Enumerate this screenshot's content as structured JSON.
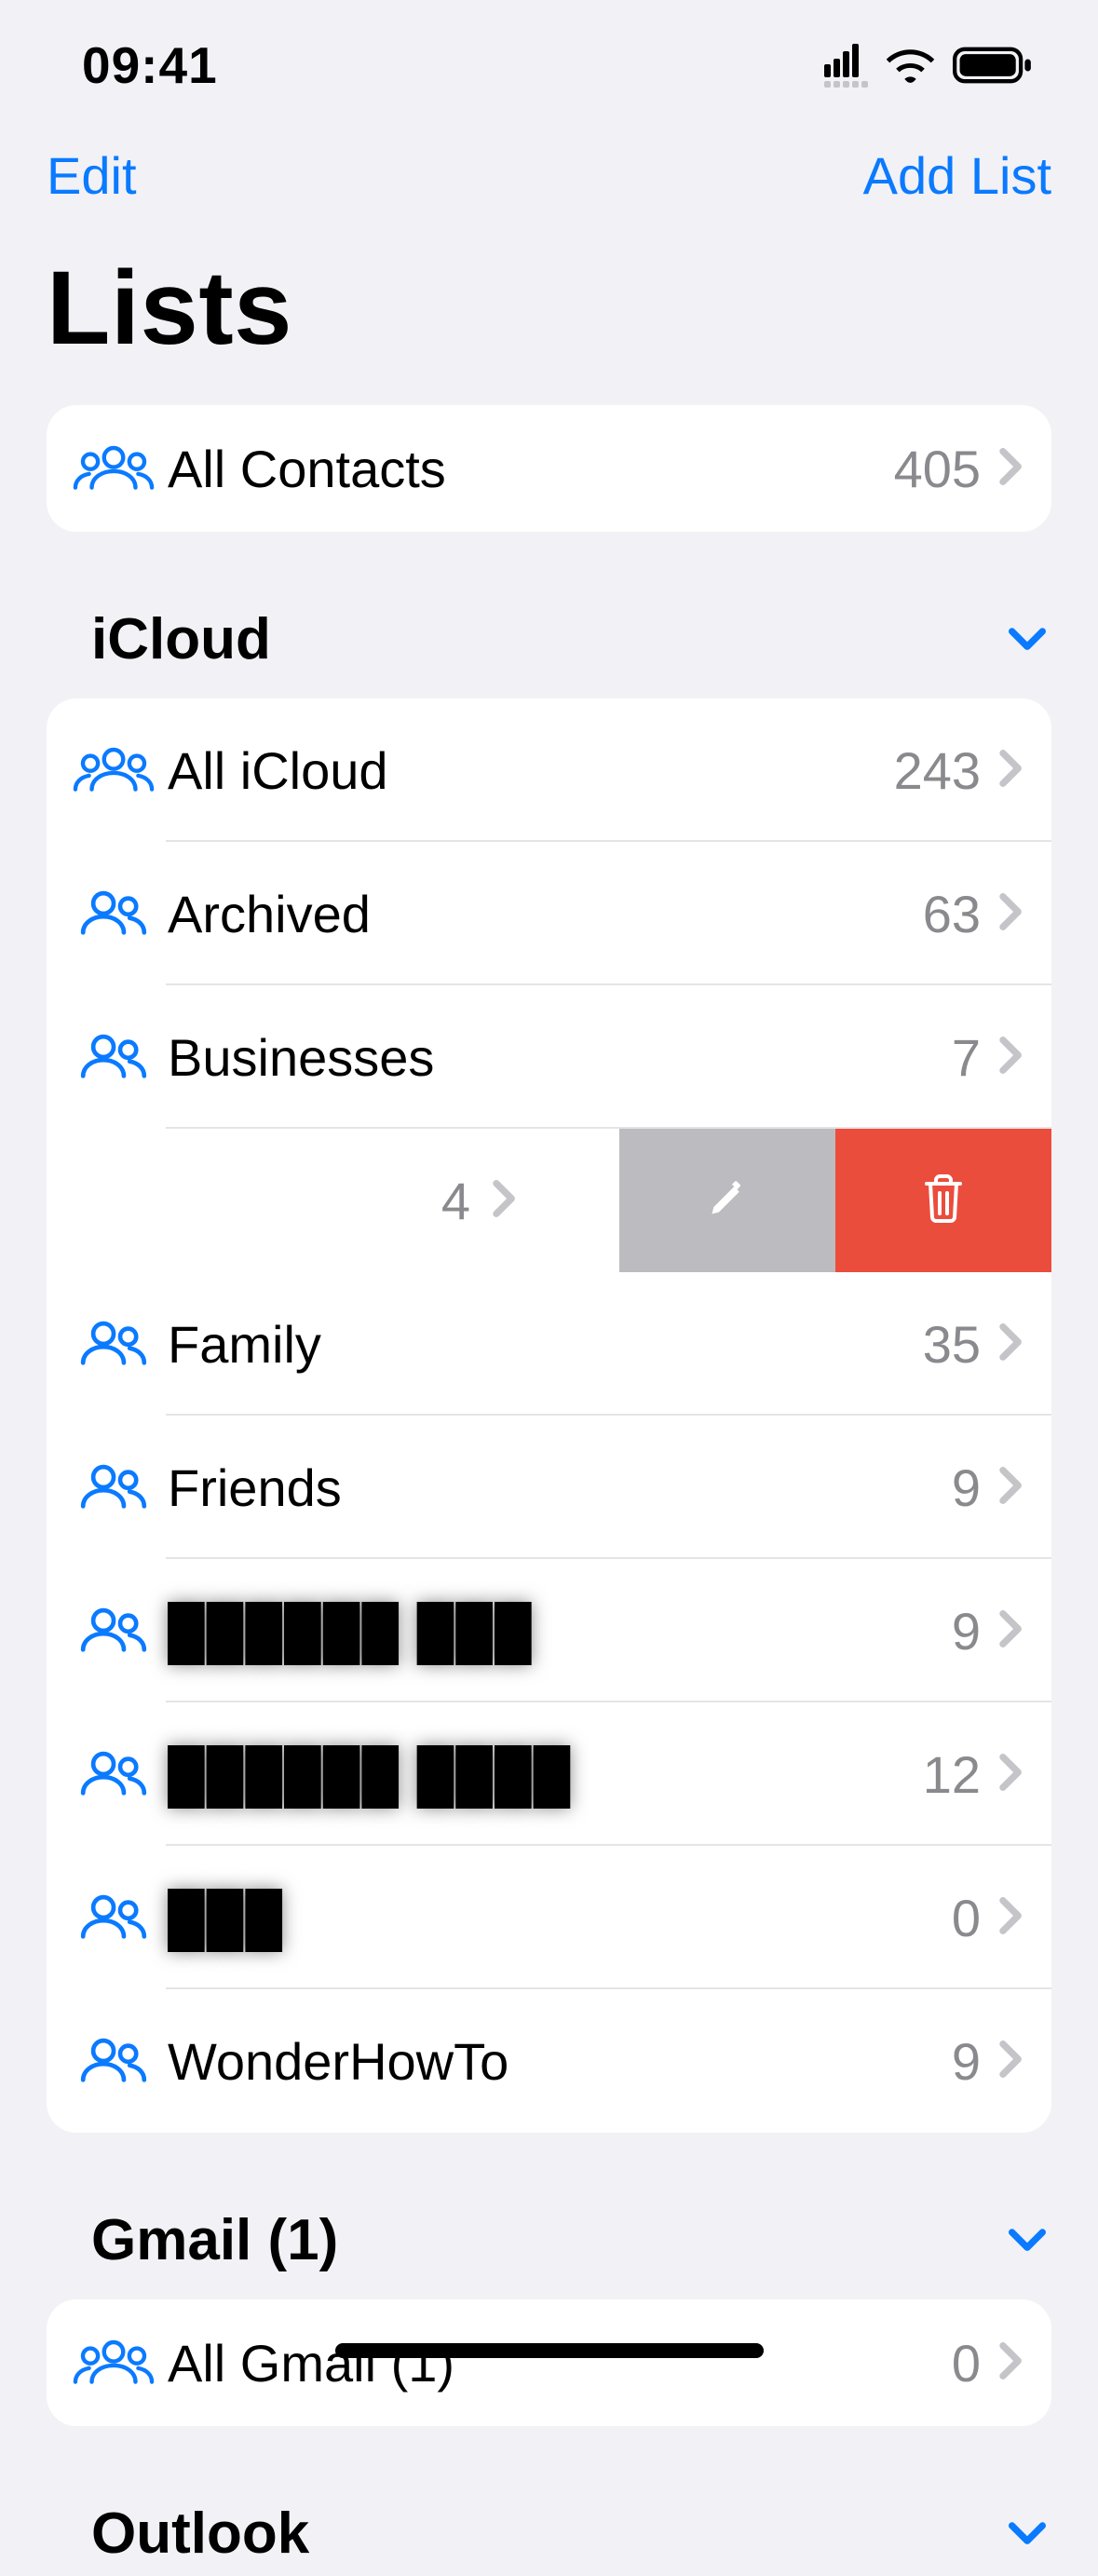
{
  "status": {
    "time": "09:41"
  },
  "nav": {
    "edit": "Edit",
    "addList": "Add List"
  },
  "title": "Lists",
  "allContacts": {
    "label": "All Contacts",
    "count": "405"
  },
  "sections": {
    "icloud": {
      "title": "iCloud",
      "items": [
        {
          "label": "All iCloud",
          "count": "243",
          "icon": "triple"
        },
        {
          "label": "Archived",
          "count": "63",
          "icon": "double"
        },
        {
          "label": "Businesses",
          "count": "7",
          "icon": "double"
        },
        {
          "label": "",
          "count": "4",
          "icon": "double",
          "swiped": true
        },
        {
          "label": "Family",
          "count": "35",
          "icon": "double"
        },
        {
          "label": "Friends",
          "count": "9",
          "icon": "double"
        },
        {
          "label": "██████   ███",
          "count": "9",
          "icon": "double",
          "redacted": true
        },
        {
          "label": "██████   ████",
          "count": "12",
          "icon": "double",
          "redacted": true
        },
        {
          "label": "███",
          "count": "0",
          "icon": "double",
          "redacted": true
        },
        {
          "label": "WonderHowTo",
          "count": "9",
          "icon": "double"
        }
      ]
    },
    "gmail": {
      "title": "Gmail (1)",
      "items": [
        {
          "label": "All Gmail (1)",
          "count": "0",
          "icon": "triple"
        }
      ]
    },
    "outlook": {
      "title": "Outlook"
    }
  },
  "colors": {
    "accent": "#0a7aff",
    "delete": "#eb4d3d",
    "editSwipe": "#bcbcc0"
  }
}
